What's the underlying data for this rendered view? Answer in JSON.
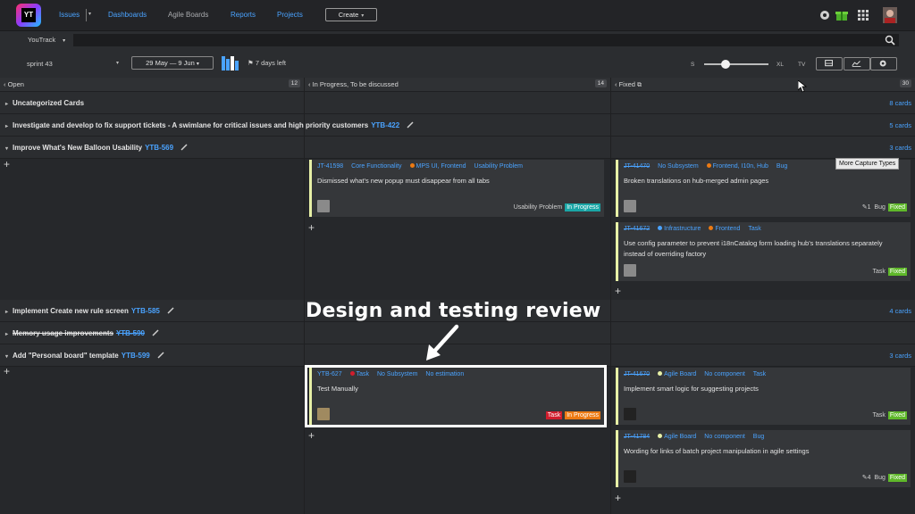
{
  "nav": {
    "logo_text": "YT",
    "items": [
      "Issues",
      "Dashboards",
      "Agile Boards",
      "Reports",
      "Projects"
    ],
    "create_label": "Create"
  },
  "search": {
    "context": "YouTrack",
    "value": "",
    "placeholder": ""
  },
  "toolbar": {
    "sprint": "sprint 43",
    "date_range": "29 May — 9 Jun",
    "days_left": "7 days left",
    "size_s": "S",
    "size_xl": "XL",
    "size_tv": "TV",
    "card_size_level": 0.27
  },
  "columns": [
    {
      "title": "Open",
      "count": "12"
    },
    {
      "title": "In Progress, To be discussed",
      "count": "14"
    },
    {
      "title": "Fixed",
      "count": "30"
    }
  ],
  "lanes": [
    {
      "name": "Uncategorized Cards",
      "id": "",
      "cards": "8 cards"
    },
    {
      "name": "Investigate and develop to fix support tickets - A swimlane for critical issues and high priority customers",
      "id": "YTB-422",
      "cards": "5 cards"
    },
    {
      "name": "Improve What's New Balloon Usability",
      "id": "YTB-569",
      "cards": "3 cards"
    },
    {
      "name": "Implement Create new rule screen",
      "id": "YTB-585",
      "cards": "4 cards"
    },
    {
      "name": "Memory usage improvements",
      "id": "YTB-590",
      "cards": ""
    },
    {
      "name": "Add \"Personal board\" template",
      "id": "YTB-599",
      "cards": "3 cards"
    }
  ],
  "cards": {
    "c1": {
      "id": "JT-41598",
      "subsystem": "Core Functionality",
      "component": "MPS UI, Frontend",
      "type": "Usability Problem",
      "summary": "Dismissed what's new popup must disappear from all tabs",
      "foot_type": "Usability Problem",
      "state": "In Progress"
    },
    "c2": {
      "id": "JT-41470",
      "subsystem": "No Subsystem",
      "component": "Frontend, I10n, Hub",
      "type": "Bug",
      "summary": "Broken translations on hub-merged admin pages",
      "comments": "1",
      "foot_type": "Bug",
      "state": "Fixed"
    },
    "c3": {
      "id": "JT-41672",
      "subsystem": "Infrastructure",
      "component": "Frontend",
      "type": "Task",
      "summary": "Use config parameter to prevent i18nCatalog form loading hub's translations separately instead of overriding factory",
      "foot_type": "Task",
      "state": "Fixed"
    },
    "c4": {
      "id": "YTB-627",
      "type": "Task",
      "subsystem": "No Subsystem",
      "estimation": "No estimation",
      "summary": "Test Manually",
      "tag_type": "Task",
      "state": "In Progress"
    },
    "c5": {
      "id": "JT-41670",
      "subsystem": "Agile Board",
      "component": "No component",
      "type": "Task",
      "summary": "Implement smart logic for suggesting projects",
      "foot_type": "Task",
      "state": "Fixed"
    },
    "c6": {
      "id": "JT-41784",
      "subsystem": "Agile Board",
      "component": "No component",
      "type": "Bug",
      "summary": "Wording for links of batch project manipulation in agile settings",
      "comments": "4",
      "foot_type": "Bug",
      "state": "Fixed"
    }
  },
  "tooltip": "More Capture Types",
  "annotation": "Design and testing review",
  "colors": {
    "accent": "#4aa3ff",
    "fixed": "#5fb82a",
    "in_progress_teal": "#1aa6a6",
    "in_progress_orange": "#ec7a13",
    "task_red": "#d11d2d"
  }
}
